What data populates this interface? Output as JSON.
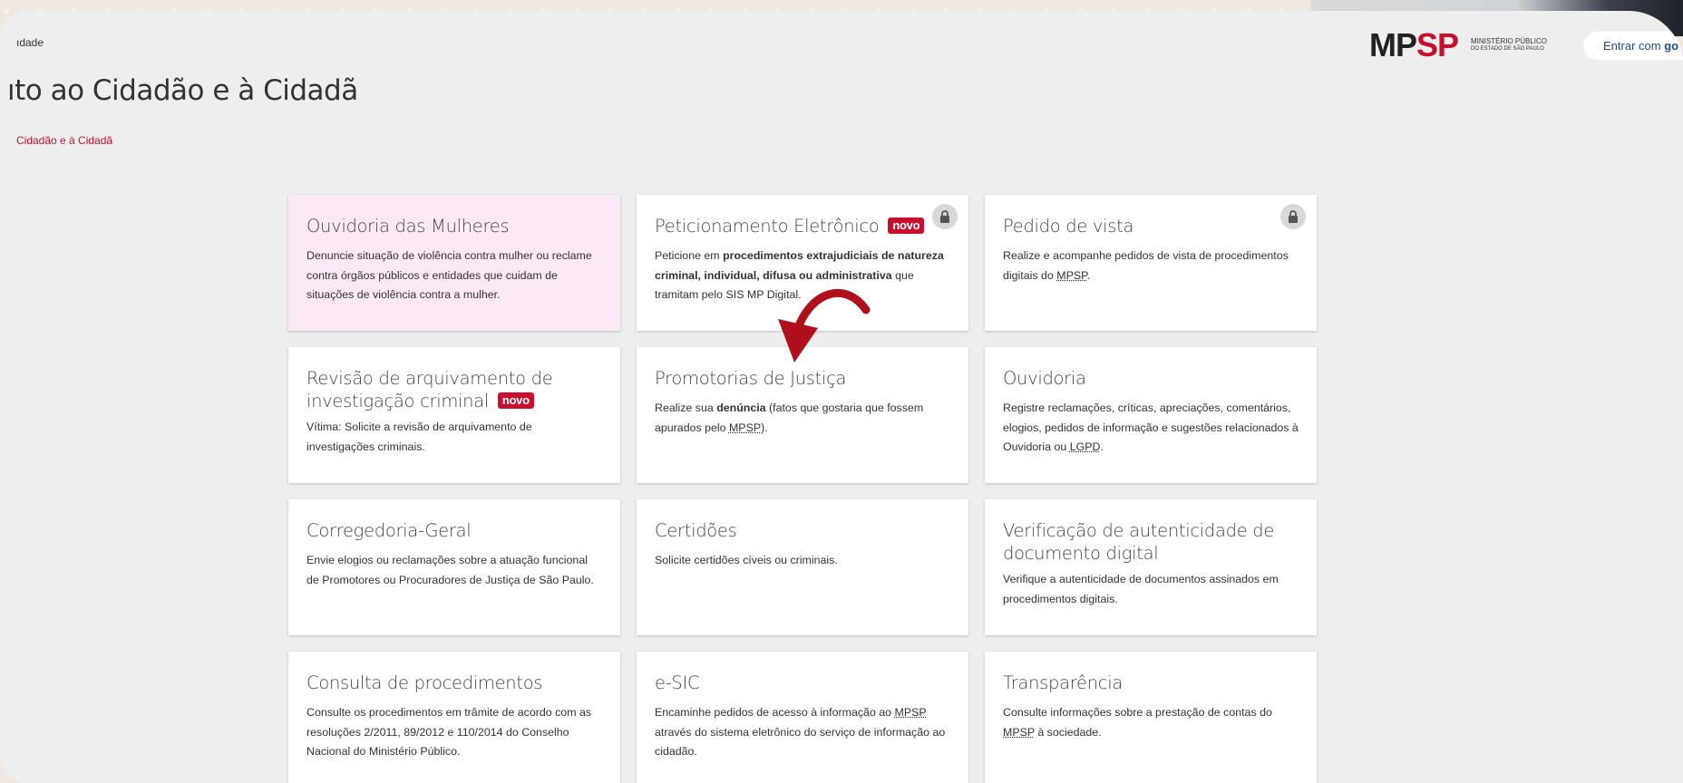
{
  "header": {
    "breadcrumb_top": "ıdade",
    "page_title": "ıto ao Cidadão e à Cidadã",
    "breadcrumb_current": "Cidadão e à Cidadã",
    "logo_mp": "MP",
    "logo_sp": "SP",
    "logo_line1": "MINISTÉRIO PÚBLICO",
    "logo_line2": "DO ESTADO DE SÃO PAULO",
    "login_text": "Entrar com ",
    "login_bold": "go"
  },
  "badge_new": "novo",
  "cards": [
    {
      "title": "Ouvidoria das Mulheres",
      "desc": "Denuncie situação de violência contra mulher ou reclame contra órgãos públicos e entidades que cuidam de situações de violência contra a mulher."
    },
    {
      "title": "Peticionamento Eletrônico",
      "desc_a": "Peticione em ",
      "desc_b": "procedimentos extrajudiciais de natureza criminal, individual, difusa ou administrativa",
      "desc_c": " que tramitam pelo SIS MP Digital."
    },
    {
      "title": "Pedido de vista",
      "desc_a": "Realize e acompanhe pedidos de vista de procedimentos digitais do ",
      "desc_abbr": "MPSP",
      "desc_c": "."
    },
    {
      "title_line1": "Revisão de arquivamento de",
      "title_line2": "investigação criminal",
      "desc": "Vítima: Solicite a revisão de arquivamento de investigações criminais."
    },
    {
      "title": "Promotorias de Justiça",
      "desc_a": "Realize sua ",
      "desc_b": "denúncia",
      "desc_c": " (fatos que gostaria que fossem apurados pelo ",
      "desc_abbr": "MPSP",
      "desc_d": ")."
    },
    {
      "title": "Ouvidoria",
      "desc_a": "Registre reclamações, críticas, apreciações, comentários, elogios, pedidos de informação e sugestões relacionados à Ouvidoria ou ",
      "desc_abbr": "LGPD",
      "desc_c": "."
    },
    {
      "title": "Corregedoria-Geral",
      "desc": "Envie elogios ou reclamações sobre a atuação funcional de Promotores ou Procuradores de Justiça de São Paulo."
    },
    {
      "title": "Certidões",
      "desc": "Solicite certidões cíveis ou criminais."
    },
    {
      "title": "Verificação de autenticidade de documento digital",
      "desc": "Verifique a autenticidade de documentos assinados em procedimentos digitais."
    },
    {
      "title": "Consulta de procedimentos",
      "desc": "Consulte os procedimentos em trâmite de acordo com as resoluções 2/2011, 89/2012 e 110/2014 do Conselho Nacional do Ministério Público."
    },
    {
      "title": "e-SIC",
      "desc_a": "Encaminhe pedidos de acesso à informação ao ",
      "desc_abbr": "MPSP",
      "desc_c": " através do sistema eletrônico do serviço de informação ao cidadão."
    },
    {
      "title": "Transparência",
      "desc_a": "Consulte informações sobre a prestação de contas do ",
      "desc_abbr": "MPSP",
      "desc_c": " à sociedade."
    }
  ],
  "colors": {
    "accent_red": "#c8102e",
    "pink_card": "#fbeaf6",
    "link_blue": "#1d4f91"
  }
}
